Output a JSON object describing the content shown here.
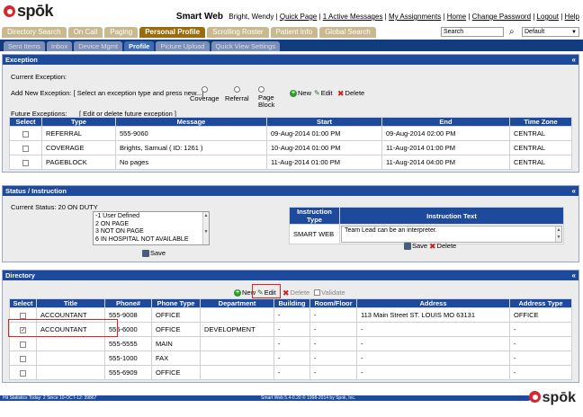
{
  "header": {
    "logo_text": "spōk",
    "app_name": "Smart Web",
    "user_name": "Bright, Wendy",
    "links": [
      "Quick Page",
      "1 Active Messages",
      "My Assignments",
      "Home",
      "Change Password",
      "Logout",
      "Help"
    ],
    "search_value": "Search",
    "default_select": "Default"
  },
  "main_tabs": [
    "Directory Search",
    "On Call",
    "Paging",
    "Personal Profile",
    "Scrolling Roster",
    "Patient Info",
    "Global Search"
  ],
  "sub_tabs": [
    "Sent Items",
    "Inbox",
    "Device Mgmt",
    "Profile",
    "Picture Upload",
    "Quick View Settings"
  ],
  "exception": {
    "title": "Exception",
    "current_label": "Current Exception:",
    "add_label": "Add New Exception:  [ Select an exception type and press new...]",
    "radio_options": [
      "Coverage",
      "Referral",
      "Page Block"
    ],
    "new_label": "New",
    "edit_label": "Edit",
    "delete_label": "Delete",
    "future_label": "Future Exceptions:",
    "future_hint": "[ Edit or delete future exception ]",
    "columns": [
      "Select",
      "Type",
      "Message",
      "Start",
      "End",
      "Time Zone"
    ],
    "rows": [
      {
        "type": "REFERRAL",
        "message": "555-9060",
        "start": "09-Aug-2014 01:00 PM",
        "end": "09-Aug-2014 02:00 PM",
        "tz": "CENTRAL"
      },
      {
        "type": "COVERAGE",
        "message": "Brights, Samual ( ID: 1261 )",
        "start": "10-Aug-2014 01:00 PM",
        "end": "11-Aug-2014 01:00 PM",
        "tz": "CENTRAL"
      },
      {
        "type": "PAGEBLOCK",
        "message": "No pages",
        "start": "11-Aug-2014 01:00 PM",
        "end": "11-Aug-2014 04:00 PM",
        "tz": "CENTRAL"
      }
    ]
  },
  "status": {
    "title": "Status / Instruction",
    "current_label": "Current Status: 20   ON DUTY",
    "list_items": [
      "-1 User Defined",
      "2 ON PAGE",
      "3 NOT ON PAGE",
      "6 IN HOSPITAL NOT AVAILABLE"
    ],
    "save_label": "Save",
    "instr_columns": [
      "Instruction Type",
      "Instruction Text"
    ],
    "instr_type": "SMART WEB",
    "instr_text": "Team Lead can be an interpreter.",
    "save2_label": "Save",
    "delete_label": "Delete"
  },
  "directory": {
    "title": "Directory",
    "new_label": "New",
    "edit_label": "Edit",
    "delete_label": "Delete",
    "validate_label": "Validate",
    "columns": [
      "Select",
      "Title",
      "Phone#",
      "Phone Type",
      "Department",
      "Building",
      "Room/Floor",
      "Address",
      "Address Type"
    ],
    "rows": [
      {
        "checked": false,
        "title": "ACCOUNTANT",
        "phone": "555-9008",
        "ptype": "OFFICE",
        "dept": "",
        "bldg": "-",
        "room": "-",
        "addr": "113 Main Street ST. LOUIS MO 63131",
        "atype": "OFFICE"
      },
      {
        "checked": true,
        "title": "ACCOUNTANT",
        "phone": "555-6000",
        "ptype": "OFFICE",
        "dept": "DEVELOPMENT",
        "bldg": "-",
        "room": "-",
        "addr": "-",
        "atype": "-"
      },
      {
        "checked": false,
        "title": "",
        "phone": "555-5555",
        "ptype": "MAIN",
        "dept": "",
        "bldg": "-",
        "room": "-",
        "addr": "-",
        "atype": "-"
      },
      {
        "checked": false,
        "title": "",
        "phone": "555-1000",
        "ptype": "FAX",
        "dept": "",
        "bldg": "-",
        "room": "-",
        "addr": "-",
        "atype": "-"
      },
      {
        "checked": false,
        "title": "",
        "phone": "555-6909",
        "ptype": "OFFICE",
        "dept": "",
        "bldg": "-",
        "room": "-",
        "addr": "-",
        "atype": "-"
      }
    ]
  },
  "footer": {
    "left": "Hit Statistics Today: 2 Since 10-OCT-12: 39867",
    "center": "Smart Web 5.4-0.20 © 1998-2014 by Spok, Inc.",
    "logo_text": "spōk"
  },
  "colors": {
    "brand_red": "#d8262f",
    "nav_blue": "#1d4a9c",
    "tab_gold": "#9b6c0b",
    "highlight": "#e12222"
  }
}
